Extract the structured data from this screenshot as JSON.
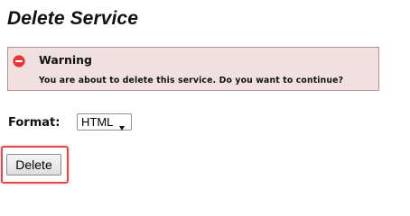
{
  "page": {
    "title": "Delete Service"
  },
  "warning": {
    "icon": "error-circle-icon",
    "icon_color": "#e53535",
    "title": "Warning",
    "message": "You are about to delete this service. Do you want to continue?",
    "background_color": "#f1e0e0",
    "border_color": "#b98f8f"
  },
  "format": {
    "label": "Format:",
    "selected": "HTML"
  },
  "actions": {
    "delete_label": "Delete",
    "highlight_color": "#e04b4b"
  }
}
